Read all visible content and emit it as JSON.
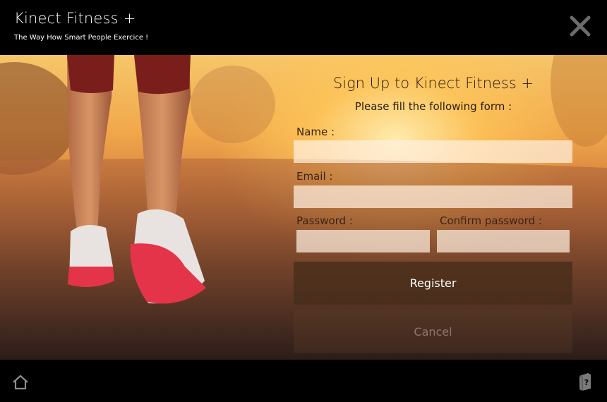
{
  "app": {
    "title": "Kinect Fitness +",
    "subtitle": "The Way How Smart People Exercice !"
  },
  "header": {
    "close_icon": "close-icon"
  },
  "form": {
    "title": "Sign Up to Kinect Fitness +",
    "subtitle": "Please fill the following form :",
    "name_label": "Name :",
    "name_value": "",
    "email_label": "Email :",
    "email_value": "",
    "password_label": "Password :",
    "password_value": "",
    "confirm_label": "Confirm password :",
    "confirm_value": "",
    "register_label": "Register",
    "cancel_label": "Cancel"
  },
  "footer": {
    "home_icon": "home-icon",
    "help_icon": "help-icon"
  },
  "colors": {
    "header_bg": "#000000",
    "register_bg": "#462d19",
    "field_bg": "#fff0e1"
  }
}
